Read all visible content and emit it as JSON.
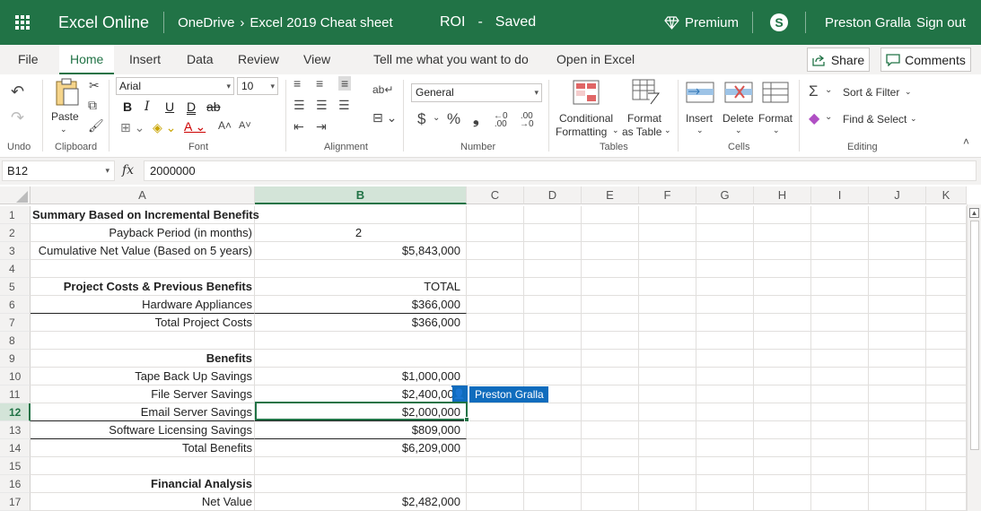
{
  "titlebar": {
    "app_name": "Excel Online",
    "breadcrumb_root": "OneDrive",
    "breadcrumb_sep": "›",
    "breadcrumb_file": "Excel 2019 Cheat sheet",
    "doc_name": "ROI",
    "doc_sep": "-",
    "doc_status": "Saved",
    "premium_label": "Premium",
    "skype_glyph": "S",
    "user_name": "Preston Gralla",
    "sign_out": "Sign out"
  },
  "menu": {
    "tabs": [
      "File",
      "Home",
      "Insert",
      "Data",
      "Review",
      "View"
    ],
    "active_tab": "Home",
    "tell_me": "Tell me what you want to do",
    "open_in_excel": "Open in Excel",
    "share": "Share",
    "comments": "Comments"
  },
  "ribbon": {
    "groups": {
      "undo": "Undo",
      "clipboard": "Clipboard",
      "font": "Font",
      "alignment": "Alignment",
      "number": "Number",
      "tables": "Tables",
      "cells": "Cells",
      "editing": "Editing"
    },
    "paste": "Paste",
    "font_name": "Arial",
    "font_size": "10",
    "bold": "B",
    "italic": "I",
    "underline": "U",
    "double_underline": "D",
    "strike": "ab",
    "number_format": "General",
    "currency": "$",
    "percent": "%",
    "comma": "❟",
    "conditional_formatting": "Conditional",
    "conditional_formatting_2": "Formatting",
    "format_as_table": "Format",
    "format_as_table_2": "as Table",
    "insert": "Insert",
    "delete": "Delete",
    "format": "Format",
    "sort_filter": "Sort & Filter",
    "find_select": "Find & Select"
  },
  "formula_bar": {
    "name_box": "B12",
    "fx": "fx",
    "value": "2000000"
  },
  "grid": {
    "columns": [
      "A",
      "B",
      "C",
      "D",
      "E",
      "F",
      "G",
      "H",
      "I",
      "J",
      "K"
    ],
    "selected_column": "B",
    "selected_row": "12",
    "rows": [
      {
        "n": "1",
        "a": "Summary Based on Incremental Benefits",
        "b": ""
      },
      {
        "n": "2",
        "a": "Payback Period (in months)",
        "b": "2"
      },
      {
        "n": "3",
        "a": "Cumulative Net Value  (Based on 5 years)",
        "b": "$5,843,000"
      },
      {
        "n": "4",
        "a": "",
        "b": ""
      },
      {
        "n": "5",
        "a": "Project Costs & Previous Benefits",
        "b": "TOTAL"
      },
      {
        "n": "6",
        "a": "Hardware Appliances",
        "b": "$366,000"
      },
      {
        "n": "7",
        "a": "Total Project Costs",
        "b": "$366,000"
      },
      {
        "n": "8",
        "a": "",
        "b": ""
      },
      {
        "n": "9",
        "a": "Benefits",
        "b": ""
      },
      {
        "n": "10",
        "a": "Tape Back Up Savings",
        "b": "$1,000,000"
      },
      {
        "n": "11",
        "a": "File Server Savings",
        "b": "$2,400,000"
      },
      {
        "n": "12",
        "a": "Email Server Savings",
        "b": "$2,000,000"
      },
      {
        "n": "13",
        "a": "Software Licensing Savings",
        "b": "$809,000"
      },
      {
        "n": "14",
        "a": "Total Benefits",
        "b": "$6,209,000"
      },
      {
        "n": "15",
        "a": "",
        "b": ""
      },
      {
        "n": "16",
        "a": "Financial Analysis",
        "b": ""
      },
      {
        "n": "17",
        "a": "Net Value",
        "b": "$2,482,000"
      }
    ],
    "collaborator": "Preston Gralla"
  },
  "colors": {
    "brand": "#217346",
    "collab": "#0f6cbd"
  }
}
